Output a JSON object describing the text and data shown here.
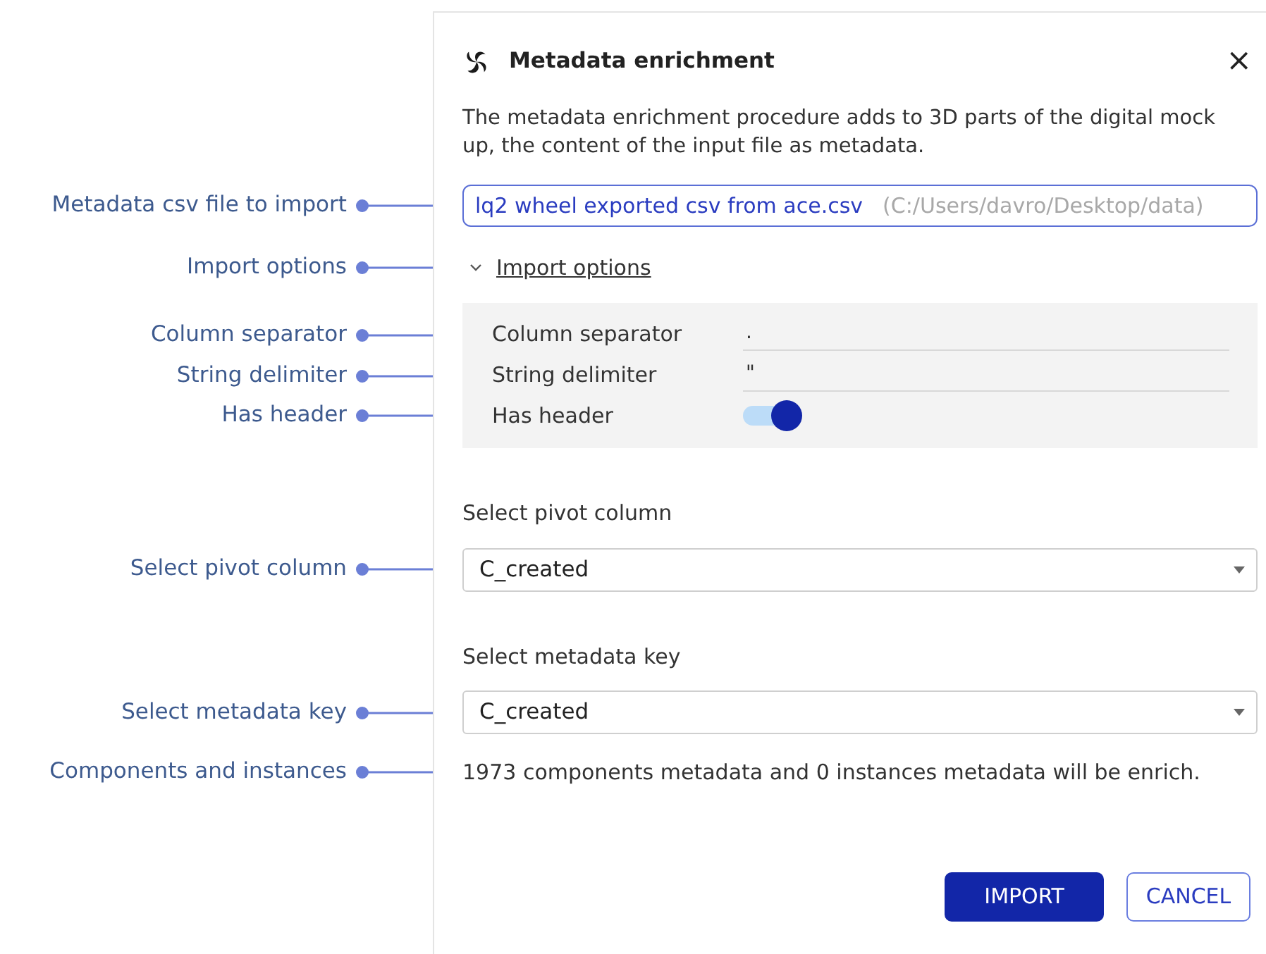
{
  "callouts": [
    {
      "text": "Metadata csv file to import"
    },
    {
      "text": "Import options"
    },
    {
      "text": "Column separator"
    },
    {
      "text": "String delimiter"
    },
    {
      "text": "Has header"
    },
    {
      "text": "Select pivot column"
    },
    {
      "text": "Select metadata key"
    },
    {
      "text": "Components and instances"
    }
  ],
  "dialog": {
    "title": "Metadata enrichment",
    "close": "×",
    "description": "The metadata enrichment procedure adds to 3D parts of the digital mock up, the content of the input file as metadata.",
    "file_field": {
      "value": "lq2 wheel exported csv from ace.csv",
      "path": "(C:/Users/davro/Desktop/data)"
    },
    "import_options": {
      "label": "Import options",
      "expanded": true,
      "fields": [
        {
          "kind": "text",
          "label": "Column separator",
          "value": "."
        },
        {
          "kind": "text",
          "label": "String delimiter",
          "value": "\""
        },
        {
          "kind": "toggle",
          "label": "Has header",
          "on": true
        }
      ]
    },
    "pivot_column": {
      "label": "Select pivot column",
      "value": "C_created"
    },
    "metadata_key": {
      "label": "Select metadata key",
      "value": "C_created"
    },
    "summary": "1973 components metadata and 0 instances metadata will be enrich.",
    "buttons": [
      {
        "label": "IMPORT",
        "kind": "primary"
      },
      {
        "label": "CANCEL",
        "kind": "outline"
      }
    ]
  }
}
